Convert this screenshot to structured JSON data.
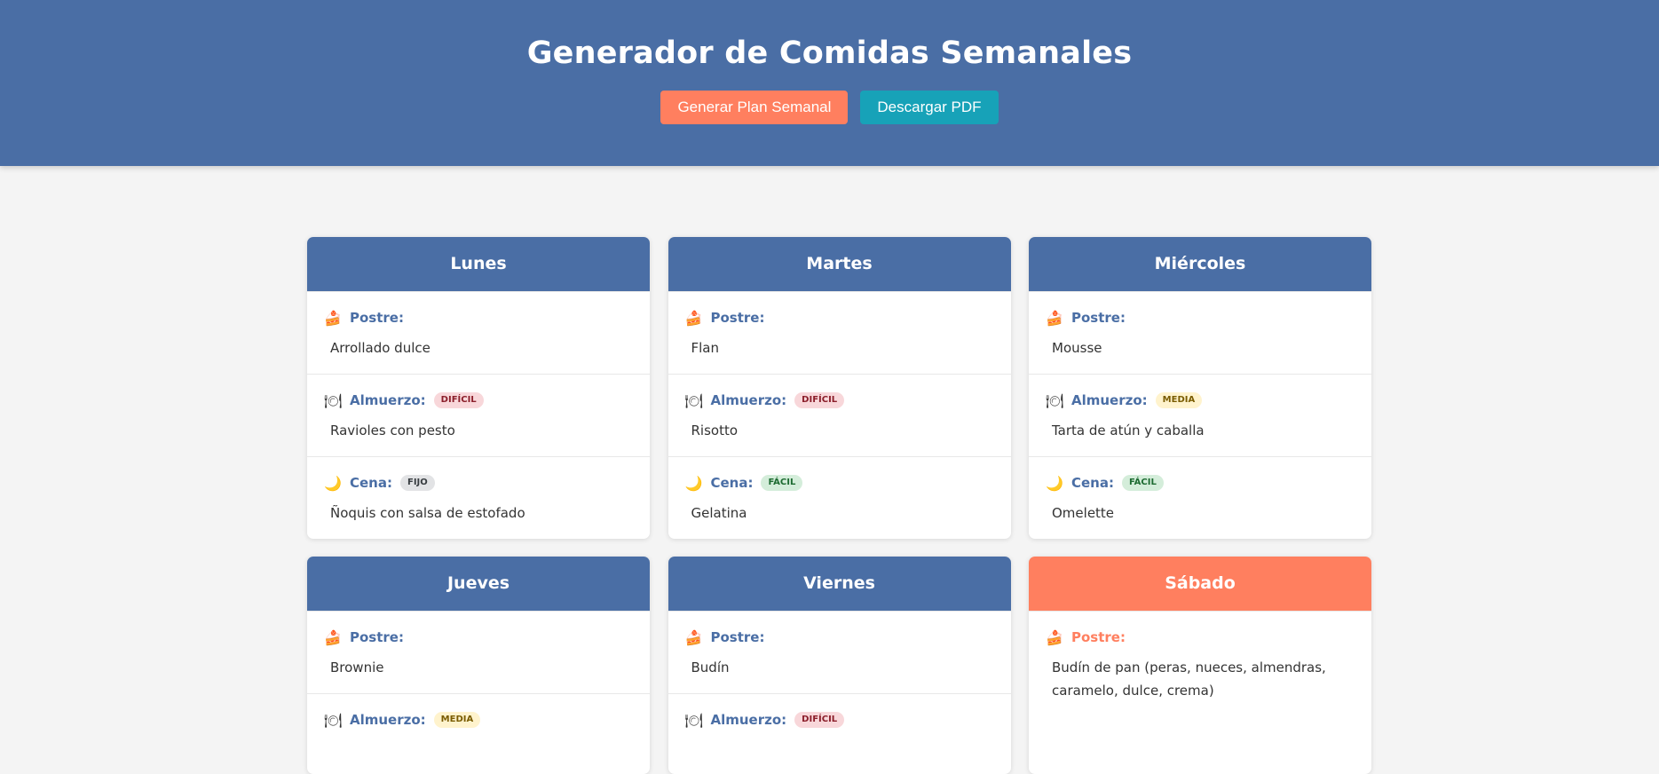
{
  "header": {
    "title": "Generador de Comidas Semanales",
    "generate_label": "Generar Plan Semanal",
    "download_label": "Descargar PDF"
  },
  "colors": {
    "primary": "#4a6ea5",
    "accent": "#ff7f5f",
    "download": "#17a2b8"
  },
  "meal_labels": {
    "postre": "Postre:",
    "almuerzo": "Almuerzo:",
    "cena": "Cena:"
  },
  "icons": {
    "postre": "cake-icon",
    "almuerzo": "plate-icon",
    "cena": "moon-icon"
  },
  "days": [
    {
      "name": "Lunes",
      "postre": "Arrollado dulce",
      "almuerzo": "Ravioles con pesto",
      "almuerzo_badge": "DIFÍCIL",
      "cena": "Ñoquis con salsa de estofado",
      "cena_badge": "FIJO"
    },
    {
      "name": "Martes",
      "postre": "Flan",
      "almuerzo": "Risotto",
      "almuerzo_badge": "DIFÍCIL",
      "cena": "Gelatina",
      "cena_badge": "FÁCIL"
    },
    {
      "name": "Miércoles",
      "postre": "Mousse",
      "almuerzo": "Tarta de atún y caballa",
      "almuerzo_badge": "MEDIA",
      "cena": "Omelette",
      "cena_badge": "FÁCIL"
    },
    {
      "name": "Jueves",
      "postre": "Brownie",
      "almuerzo": "",
      "almuerzo_badge": "MEDIA"
    },
    {
      "name": "Viernes",
      "postre": "Budín",
      "almuerzo": "",
      "almuerzo_badge": "DIFÍCIL"
    },
    {
      "name": "Sábado",
      "postre": "Budín de pan (peras, nueces, almendras, caramelo, dulce, crema)",
      "weekend": true
    }
  ]
}
